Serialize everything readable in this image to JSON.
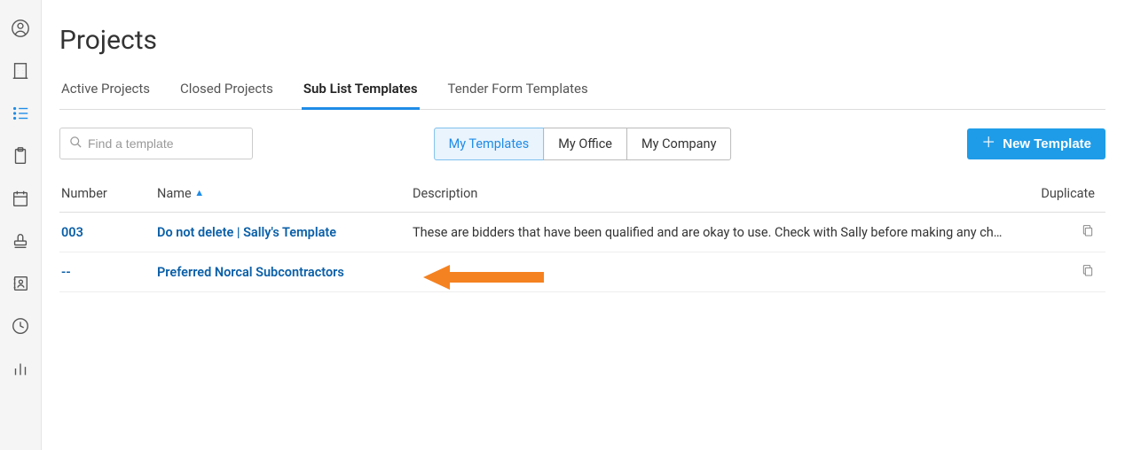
{
  "page": {
    "title": "Projects"
  },
  "tabs": {
    "items": [
      {
        "label": "Active Projects",
        "active": false
      },
      {
        "label": "Closed Projects",
        "active": false
      },
      {
        "label": "Sub List Templates",
        "active": true
      },
      {
        "label": "Tender Form Templates",
        "active": false
      }
    ]
  },
  "search": {
    "placeholder": "Find a template"
  },
  "segments": {
    "items": [
      {
        "label": "My Templates",
        "active": true
      },
      {
        "label": "My Office",
        "active": false
      },
      {
        "label": "My Company",
        "active": false
      }
    ]
  },
  "new_button": {
    "label": "New Template"
  },
  "table": {
    "headers": {
      "number": "Number",
      "name": "Name",
      "description": "Description",
      "duplicate": "Duplicate"
    },
    "rows": [
      {
        "number": "003",
        "name": "Do not delete | Sally's Template",
        "description": "These are bidders that have been qualified and are okay to use. Check with Sally before making any ch…"
      },
      {
        "number": "--",
        "name": "Preferred Norcal Subcontractors",
        "description": ""
      }
    ]
  },
  "sidebar": {
    "icons": [
      "user-icon",
      "building-icon",
      "list-icon",
      "clipboard-icon",
      "calendar-icon",
      "stamp-icon",
      "contacts-icon",
      "clock-icon",
      "chart-icon"
    ]
  }
}
